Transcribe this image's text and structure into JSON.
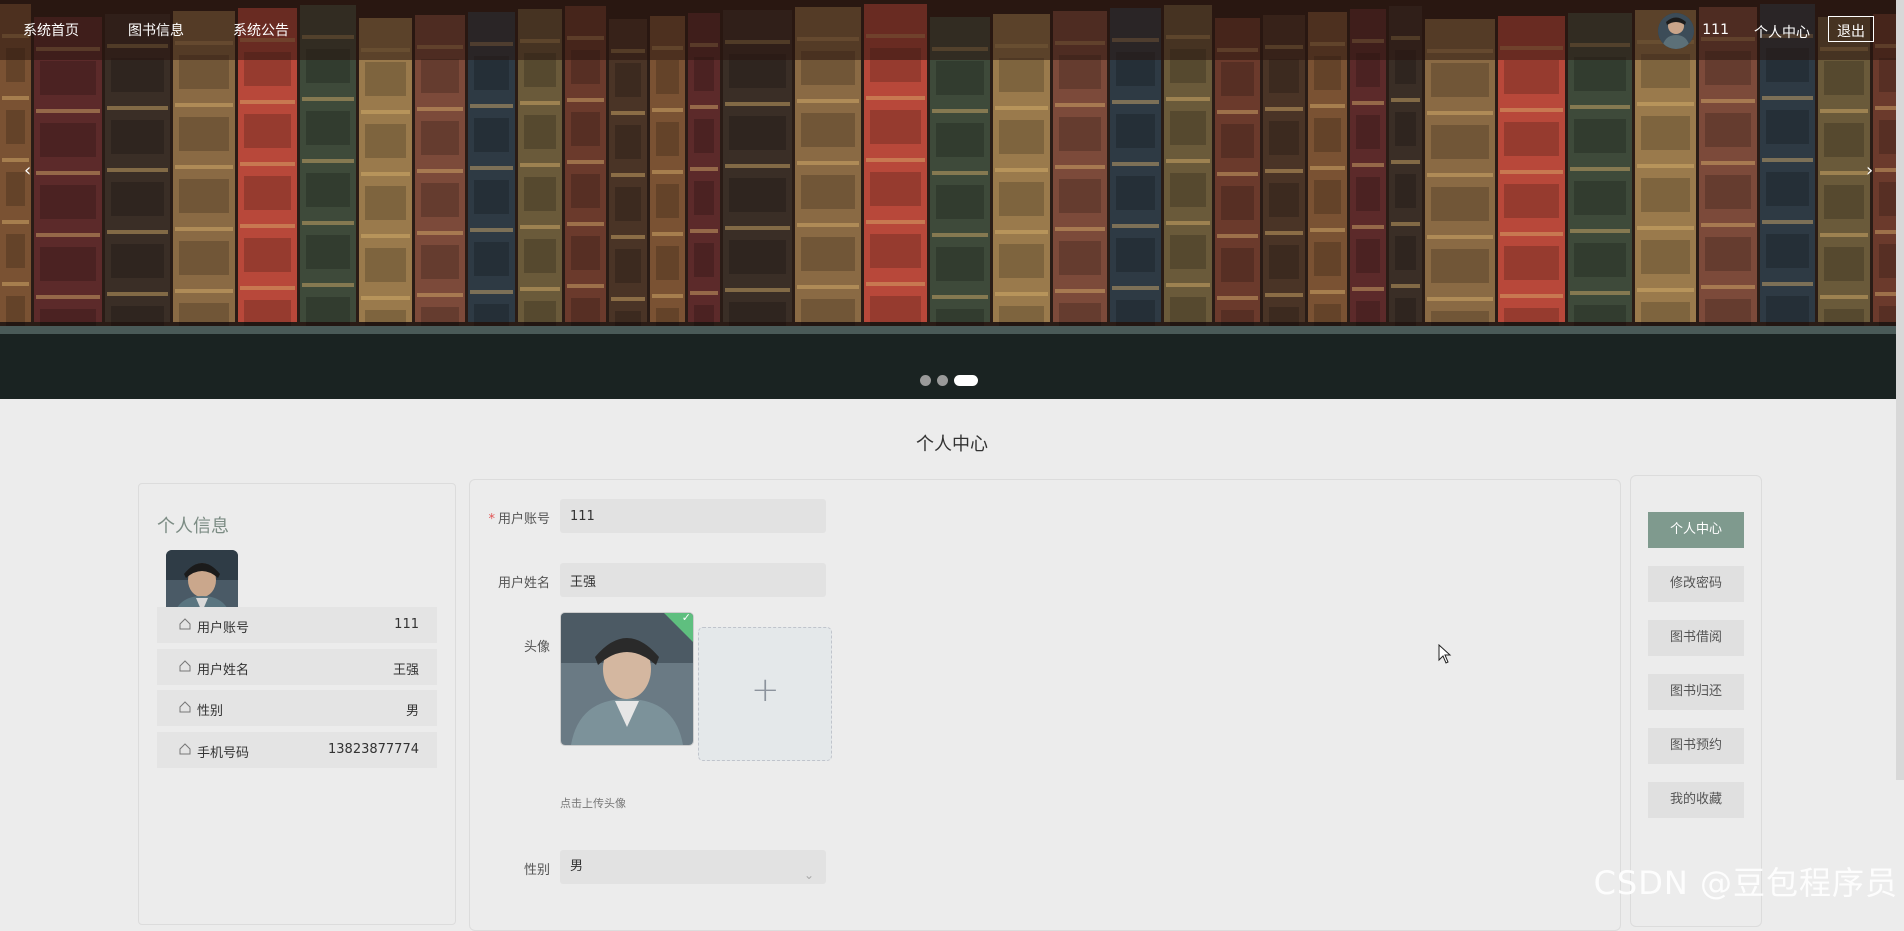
{
  "nav": {
    "items": [
      "系统首页",
      "图书信息",
      "系统公告"
    ],
    "username": "111",
    "center_link": "个人中心",
    "logout": "退出"
  },
  "banner": {
    "prev_glyph": "‹",
    "next_glyph": "›",
    "slide_count": 3,
    "active_slide": 3
  },
  "page_title": "个人中心",
  "profile": {
    "title": "个人信息",
    "rows": [
      {
        "label": "用户账号",
        "value": "111"
      },
      {
        "label": "用户姓名",
        "value": "王强"
      },
      {
        "label": "性别",
        "value": "男"
      },
      {
        "label": "手机号码",
        "value": "13823877774"
      }
    ]
  },
  "form": {
    "account_label": "用户账号",
    "account_value": "111",
    "name_label": "用户姓名",
    "name_value": "王强",
    "avatar_label": "头像",
    "upload_plus": "+",
    "upload_tip": "点击上传头像",
    "gender_label": "性别",
    "gender_value": "男",
    "required_mark": "*"
  },
  "side_menu": [
    "个人中心",
    "修改密码",
    "图书借阅",
    "图书归还",
    "图书预约",
    "我的收藏"
  ],
  "watermark": "CSDN @豆包程序员",
  "colors": {
    "accent": "#7f9a8e",
    "success": "#5fbf7f",
    "required": "#e05353"
  }
}
